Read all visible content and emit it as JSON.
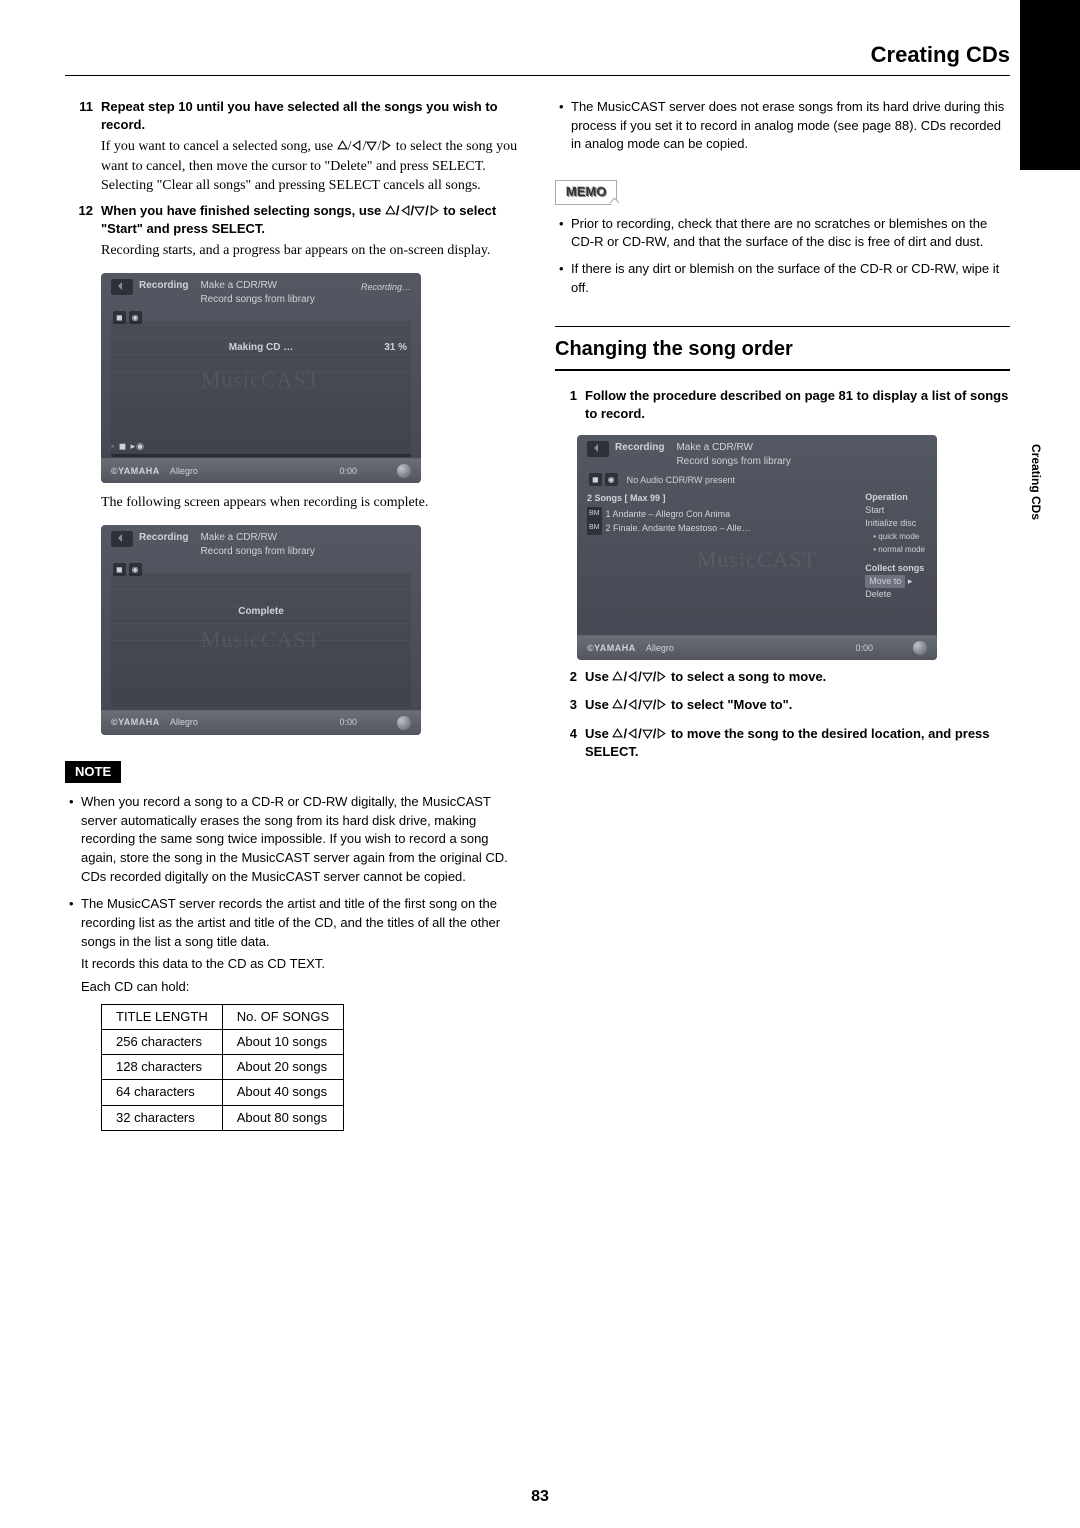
{
  "header": {
    "title": "Creating CDs"
  },
  "side_tab": "Creating CDs",
  "page_number": "83",
  "left": {
    "step11": {
      "num": "11",
      "bold": "Repeat step 10 until you have selected all the songs you wish to record.",
      "plain_before": "If you want to cancel a selected song, use ",
      "plain_after": " to select the song you want to cancel, then move the cursor to \"Delete\" and press SELECT. Selecting \"Clear all songs\" and pressing SELECT cancels all songs."
    },
    "step12": {
      "num": "12",
      "bold_before": "When you have finished selecting songs, use ",
      "bold_after": " to select \"Start\" and press SELECT.",
      "plain": "Recording starts, and a progress bar appears on the on-screen display."
    },
    "ss1": {
      "crumb": "Recording",
      "title": "Make a CDR/RW",
      "subtitle": "Record songs from library",
      "status": "Recording…",
      "making": "Making CD …",
      "pct": "31 %",
      "brand": "MusicCAST",
      "footer_brand": "©YAMAHA",
      "footer_track": "Allegro",
      "footer_time": "0:00"
    },
    "caption1": "The following screen appears when recording is complete.",
    "ss2": {
      "crumb": "Recording",
      "title": "Make a CDR/RW",
      "subtitle": "Record songs from library",
      "center": "Complete",
      "brand": "MusicCAST",
      "footer_brand": "©YAMAHA",
      "footer_track": "Allegro",
      "footer_time": "0:00"
    },
    "note_label": "NOTE",
    "note_bullets": [
      "When you record a song to a CD-R or CD-RW digitally, the MusicCAST server automatically erases the song from its hard disk drive, making recording the same song twice impossible. If you wish to record a song again, store the song in the MusicCAST server again from the original CD. CDs recorded digitally on the MusicCAST server cannot be copied.",
      "The MusicCAST server records the artist and title of the first song on the recording list as the artist and title of the CD, and the titles of all the other songs in the list a song title data."
    ],
    "note_tail1": "It records this data to the CD as CD TEXT.",
    "note_tail2": "Each CD can hold:",
    "table": {
      "headers": [
        "TITLE LENGTH",
        "No. OF SONGS"
      ],
      "rows": [
        [
          "256 characters",
          "About 10 songs"
        ],
        [
          "128 characters",
          "About 20 songs"
        ],
        [
          "64 characters",
          "About 40 songs"
        ],
        [
          "32 characters",
          "About 80 songs"
        ]
      ]
    }
  },
  "right": {
    "top_bullet": "The MusicCAST server does not erase songs from its hard drive during this process if you set it to record in analog mode (see page 88). CDs recorded in analog mode can be copied.",
    "memo_label": "MEMO",
    "memo_bullets": [
      "Prior to recording, check that there are no scratches or blemishes on the CD-R or CD-RW, and that the surface of the disc is free of dirt and dust.",
      "If there is any dirt or blemish on the surface of the CD-R or CD-RW, wipe it off."
    ],
    "section": "Changing the song order",
    "step1": {
      "num": "1",
      "bold": "Follow the procedure described on page 81 to display a list of songs to record."
    },
    "ss3": {
      "crumb": "Recording",
      "title": "Make a CDR/RW",
      "subtitle": "Record songs from library",
      "sub2": "No Audio CDR/RW present",
      "list_hdr": "2  Songs          [ Max 99 ]",
      "list_items": [
        "1   Andante – Allegro Con Anima",
        "2   Finale. Andante Maestoso – Alle…"
      ],
      "badge": "BM",
      "ops_hdr": "Operation",
      "ops": [
        "Start",
        "Initialize disc"
      ],
      "ops_sub": [
        "• quick mode",
        "• normal mode"
      ],
      "ops2_hdr": "Collect songs",
      "ops2_hl": "Move to",
      "ops2_tail": "Delete",
      "brand": "MusicCAST",
      "footer_brand": "©YAMAHA",
      "footer_track": "Allegro",
      "footer_time": "0:00"
    },
    "step2": {
      "num": "2",
      "before": "Use ",
      "after": " to select a song to move."
    },
    "step3": {
      "num": "3",
      "before": "Use ",
      "after": " to select \"Move to\"."
    },
    "step4": {
      "num": "4",
      "before": "Use ",
      "after": " to move the song to the desired location, and press SELECT."
    }
  }
}
